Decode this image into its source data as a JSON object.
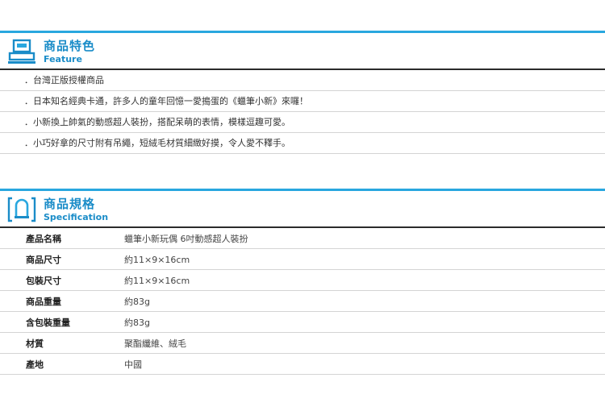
{
  "feature": {
    "title": "商品特色",
    "subtitle": "Feature",
    "icon": "register-icon",
    "items": [
      "．台灣正版授權商品",
      "．日本知名經典卡通，許多人的童年回憶一愛搗蛋的《蠟筆小新》來囉！",
      "．小新換上帥氣的動感超人裝扮，搭配呆萌的表情，模樣逗趣可愛。",
      "．小巧好拿的尺寸附有吊繩，短絨毛材質細緻好摸，令人愛不釋手。"
    ]
  },
  "spec": {
    "title": "商品規格",
    "subtitle": "Specification",
    "icon": "specification-icon",
    "rows": [
      {
        "label": "產品名稱",
        "value": "蠟筆小新玩偶 6吋動感超人裝扮"
      },
      {
        "label": "商品尺寸",
        "value": "約11×9×16cm"
      },
      {
        "label": "包裝尺寸",
        "value": "約11×9×16cm"
      },
      {
        "label": "商品重量",
        "value": "約83g"
      },
      {
        "label": "含包裝重量",
        "value": "約83g"
      },
      {
        "label": "材質",
        "value": "聚酯纖維、絨毛"
      },
      {
        "label": "產地",
        "value": "中國"
      }
    ]
  },
  "colors": {
    "accent": "#29a7df",
    "title": "#1a8cc8",
    "rule": "#2b2b2b",
    "divider": "#d4d4d4"
  }
}
